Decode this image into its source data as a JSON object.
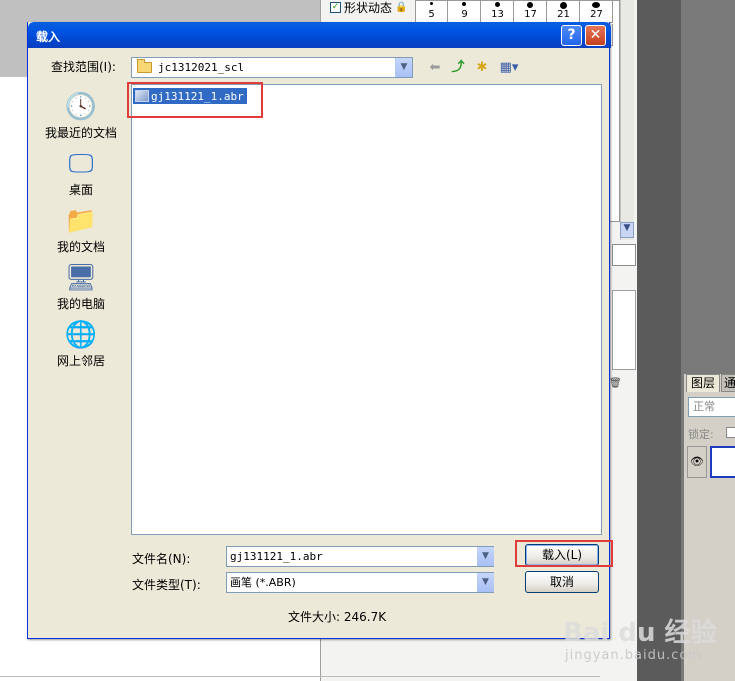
{
  "dialog": {
    "title": "载入",
    "help_glyph": "?",
    "close_glyph": "✕",
    "look_in_label": "查找范围(I):",
    "look_in_value": "jc1312021_scl",
    "toolbar_icons": [
      "back-icon",
      "up-folder-icon",
      "new-folder-icon",
      "view-menu-icon"
    ],
    "places": [
      {
        "label": "我最近的文档",
        "icon": "recent-documents-icon"
      },
      {
        "label": "桌面",
        "icon": "desktop-icon"
      },
      {
        "label": "我的文档",
        "icon": "my-documents-icon"
      },
      {
        "label": "我的电脑",
        "icon": "my-computer-icon"
      },
      {
        "label": "网上邻居",
        "icon": "network-places-icon"
      }
    ],
    "files": [
      {
        "name": "gj131121_1.abr",
        "selected": true
      }
    ],
    "filename_label": "文件名(N):",
    "filename_value": "gj131121_1.abr",
    "filetype_label": "文件类型(T):",
    "filetype_value": "画笔 (*.ABR)",
    "load_button": "载入(L)",
    "cancel_button": "取消",
    "filesize_text": "文件大小: 246.7K"
  },
  "background": {
    "shape_dynamics_label": "形状动态",
    "brush_numbers": [
      "5",
      "9",
      "13",
      "17",
      "21",
      "27"
    ],
    "layers_tab": "图层",
    "layers_tab2": "通",
    "blend_mode": "正常",
    "lock_label": "锁定:"
  },
  "watermark": {
    "logo": "Bai du 经验",
    "url": "jingyan.baidu.com"
  },
  "colors": {
    "titlebar": "#0054e3",
    "selection": "#316ac5",
    "highlight": "#e23b3b",
    "dialog_bg": "#ece9d8"
  }
}
